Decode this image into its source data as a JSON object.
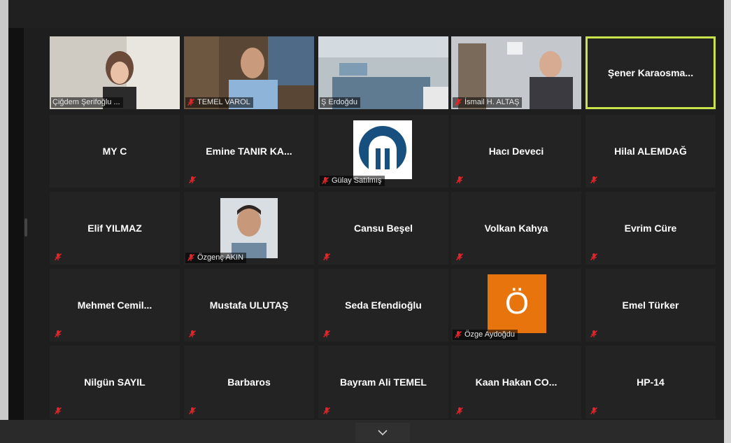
{
  "meeting": {
    "active_speaker": "Şener Karaosma...",
    "tiles": [
      {
        "name": "Çiğdem Şerifoğlu ...",
        "kind": "video",
        "muted": false
      },
      {
        "name": "TEMEL VAROL",
        "kind": "video",
        "muted": true
      },
      {
        "name": "Ş Erdoğdu",
        "kind": "video",
        "muted": false
      },
      {
        "name": "İsmail H. ALTAŞ",
        "kind": "video",
        "muted": true
      },
      {
        "name": "Şener  Karaosma...",
        "kind": "name",
        "muted": false,
        "active": true
      },
      {
        "name": "MY C",
        "kind": "name",
        "muted": false
      },
      {
        "name": "Emine TANIR KA...",
        "kind": "name",
        "muted": true
      },
      {
        "name": "Gülay Satılmış",
        "kind": "logo",
        "muted": true
      },
      {
        "name": "Hacı Deveci",
        "kind": "name",
        "muted": true
      },
      {
        "name": "Hilal ALEMDAĞ",
        "kind": "name",
        "muted": true
      },
      {
        "name": "Elif YILMAZ",
        "kind": "name",
        "muted": true
      },
      {
        "name": "Özgenç AKIN",
        "kind": "photo",
        "muted": true
      },
      {
        "name": "Cansu Beşel",
        "kind": "name",
        "muted": true
      },
      {
        "name": "Volkan Kahya",
        "kind": "name",
        "muted": true
      },
      {
        "name": "Evrim Cüre",
        "kind": "name",
        "muted": true
      },
      {
        "name": "Mehmet  Cemil...",
        "kind": "name",
        "muted": true
      },
      {
        "name": "Mustafa ULUTAŞ",
        "kind": "name",
        "muted": true
      },
      {
        "name": "Seda Efendioğlu",
        "kind": "name",
        "muted": true
      },
      {
        "name": "Özge Aydoğdu",
        "kind": "avatar",
        "avatar_letter": "Ö",
        "muted": true
      },
      {
        "name": "Emel Türker",
        "kind": "name",
        "muted": true
      },
      {
        "name": "Nilgün SAYIL",
        "kind": "name",
        "muted": true
      },
      {
        "name": "Barbaros",
        "kind": "name",
        "muted": true
      },
      {
        "name": "Bayram Ali TEMEL",
        "kind": "name",
        "muted": true
      },
      {
        "name": "Kaan  Hakan  CO...",
        "kind": "name",
        "muted": true
      },
      {
        "name": "HP-14",
        "kind": "name",
        "muted": true
      }
    ]
  },
  "colors": {
    "active_border": "#c9e44a",
    "muted_icon": "#e0262b",
    "avatar_orange": "#e8740e",
    "tile_bg": "#232323"
  },
  "icons": {
    "mic_muted": "mic-muted-icon",
    "scroll": "chevron-down-icon"
  }
}
